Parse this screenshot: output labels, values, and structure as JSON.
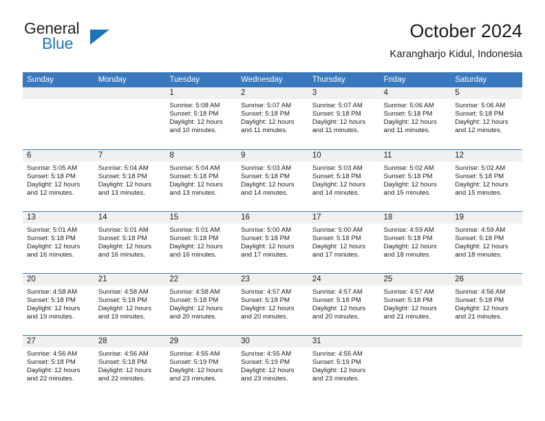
{
  "brand": {
    "name_top": "General",
    "name_bottom": "Blue",
    "accent_color": "#1b75bb",
    "triangle_icon": "brand-triangle-icon"
  },
  "header": {
    "title": "October 2024",
    "subtitle": "Karangharjo Kidul, Indonesia"
  },
  "theme": {
    "header_blue": "#3a78bd",
    "daynum_band": "#f0f0f0",
    "text": "#1a1a1a"
  },
  "weekday_headers": [
    "Sunday",
    "Monday",
    "Tuesday",
    "Wednesday",
    "Thursday",
    "Friday",
    "Saturday"
  ],
  "weeks": [
    [
      {
        "day": "",
        "lines": []
      },
      {
        "day": "",
        "lines": []
      },
      {
        "day": "1",
        "lines": [
          "Sunrise: 5:08 AM",
          "Sunset: 5:18 PM",
          "Daylight: 12 hours",
          "and 10 minutes."
        ]
      },
      {
        "day": "2",
        "lines": [
          "Sunrise: 5:07 AM",
          "Sunset: 5:18 PM",
          "Daylight: 12 hours",
          "and 11 minutes."
        ]
      },
      {
        "day": "3",
        "lines": [
          "Sunrise: 5:07 AM",
          "Sunset: 5:18 PM",
          "Daylight: 12 hours",
          "and 11 minutes."
        ]
      },
      {
        "day": "4",
        "lines": [
          "Sunrise: 5:06 AM",
          "Sunset: 5:18 PM",
          "Daylight: 12 hours",
          "and 11 minutes."
        ]
      },
      {
        "day": "5",
        "lines": [
          "Sunrise: 5:06 AM",
          "Sunset: 5:18 PM",
          "Daylight: 12 hours",
          "and 12 minutes."
        ]
      }
    ],
    [
      {
        "day": "6",
        "lines": [
          "Sunrise: 5:05 AM",
          "Sunset: 5:18 PM",
          "Daylight: 12 hours",
          "and 12 minutes."
        ]
      },
      {
        "day": "7",
        "lines": [
          "Sunrise: 5:04 AM",
          "Sunset: 5:18 PM",
          "Daylight: 12 hours",
          "and 13 minutes."
        ]
      },
      {
        "day": "8",
        "lines": [
          "Sunrise: 5:04 AM",
          "Sunset: 5:18 PM",
          "Daylight: 12 hours",
          "and 13 minutes."
        ]
      },
      {
        "day": "9",
        "lines": [
          "Sunrise: 5:03 AM",
          "Sunset: 5:18 PM",
          "Daylight: 12 hours",
          "and 14 minutes."
        ]
      },
      {
        "day": "10",
        "lines": [
          "Sunrise: 5:03 AM",
          "Sunset: 5:18 PM",
          "Daylight: 12 hours",
          "and 14 minutes."
        ]
      },
      {
        "day": "11",
        "lines": [
          "Sunrise: 5:02 AM",
          "Sunset: 5:18 PM",
          "Daylight: 12 hours",
          "and 15 minutes."
        ]
      },
      {
        "day": "12",
        "lines": [
          "Sunrise: 5:02 AM",
          "Sunset: 5:18 PM",
          "Daylight: 12 hours",
          "and 15 minutes."
        ]
      }
    ],
    [
      {
        "day": "13",
        "lines": [
          "Sunrise: 5:01 AM",
          "Sunset: 5:18 PM",
          "Daylight: 12 hours",
          "and 16 minutes."
        ]
      },
      {
        "day": "14",
        "lines": [
          "Sunrise: 5:01 AM",
          "Sunset: 5:18 PM",
          "Daylight: 12 hours",
          "and 16 minutes."
        ]
      },
      {
        "day": "15",
        "lines": [
          "Sunrise: 5:01 AM",
          "Sunset: 5:18 PM",
          "Daylight: 12 hours",
          "and 16 minutes."
        ]
      },
      {
        "day": "16",
        "lines": [
          "Sunrise: 5:00 AM",
          "Sunset: 5:18 PM",
          "Daylight: 12 hours",
          "and 17 minutes."
        ]
      },
      {
        "day": "17",
        "lines": [
          "Sunrise: 5:00 AM",
          "Sunset: 5:18 PM",
          "Daylight: 12 hours",
          "and 17 minutes."
        ]
      },
      {
        "day": "18",
        "lines": [
          "Sunrise: 4:59 AM",
          "Sunset: 5:18 PM",
          "Daylight: 12 hours",
          "and 18 minutes."
        ]
      },
      {
        "day": "19",
        "lines": [
          "Sunrise: 4:59 AM",
          "Sunset: 5:18 PM",
          "Daylight: 12 hours",
          "and 18 minutes."
        ]
      }
    ],
    [
      {
        "day": "20",
        "lines": [
          "Sunrise: 4:58 AM",
          "Sunset: 5:18 PM",
          "Daylight: 12 hours",
          "and 19 minutes."
        ]
      },
      {
        "day": "21",
        "lines": [
          "Sunrise: 4:58 AM",
          "Sunset: 5:18 PM",
          "Daylight: 12 hours",
          "and 19 minutes."
        ]
      },
      {
        "day": "22",
        "lines": [
          "Sunrise: 4:58 AM",
          "Sunset: 5:18 PM",
          "Daylight: 12 hours",
          "and 20 minutes."
        ]
      },
      {
        "day": "23",
        "lines": [
          "Sunrise: 4:57 AM",
          "Sunset: 5:18 PM",
          "Daylight: 12 hours",
          "and 20 minutes."
        ]
      },
      {
        "day": "24",
        "lines": [
          "Sunrise: 4:57 AM",
          "Sunset: 5:18 PM",
          "Daylight: 12 hours",
          "and 20 minutes."
        ]
      },
      {
        "day": "25",
        "lines": [
          "Sunrise: 4:57 AM",
          "Sunset: 5:18 PM",
          "Daylight: 12 hours",
          "and 21 minutes."
        ]
      },
      {
        "day": "26",
        "lines": [
          "Sunrise: 4:56 AM",
          "Sunset: 5:18 PM",
          "Daylight: 12 hours",
          "and 21 minutes."
        ]
      }
    ],
    [
      {
        "day": "27",
        "lines": [
          "Sunrise: 4:56 AM",
          "Sunset: 5:18 PM",
          "Daylight: 12 hours",
          "and 22 minutes."
        ]
      },
      {
        "day": "28",
        "lines": [
          "Sunrise: 4:56 AM",
          "Sunset: 5:18 PM",
          "Daylight: 12 hours",
          "and 22 minutes."
        ]
      },
      {
        "day": "29",
        "lines": [
          "Sunrise: 4:55 AM",
          "Sunset: 5:19 PM",
          "Daylight: 12 hours",
          "and 23 minutes."
        ]
      },
      {
        "day": "30",
        "lines": [
          "Sunrise: 4:55 AM",
          "Sunset: 5:19 PM",
          "Daylight: 12 hours",
          "and 23 minutes."
        ]
      },
      {
        "day": "31",
        "lines": [
          "Sunrise: 4:55 AM",
          "Sunset: 5:19 PM",
          "Daylight: 12 hours",
          "and 23 minutes."
        ]
      },
      {
        "day": "",
        "lines": []
      },
      {
        "day": "",
        "lines": []
      }
    ]
  ]
}
